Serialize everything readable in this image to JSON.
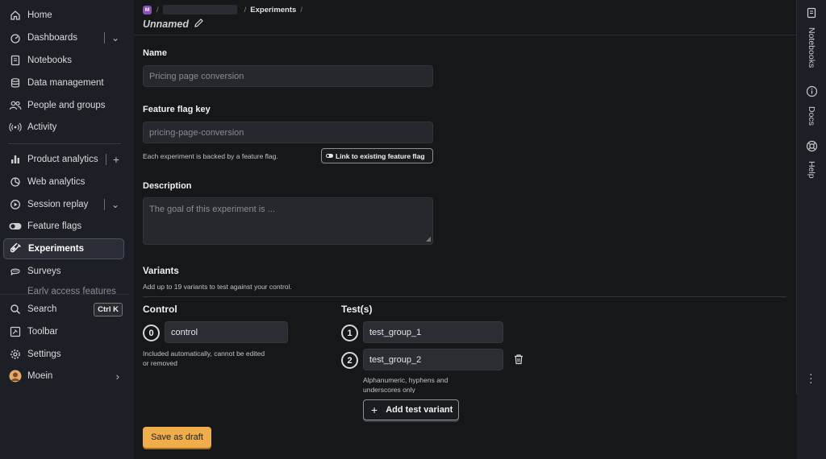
{
  "sidebar": {
    "items": [
      {
        "label": "Home",
        "icon": "home-icon"
      },
      {
        "label": "Dashboards",
        "icon": "dashboards-icon"
      },
      {
        "label": "Notebooks",
        "icon": "notebook-icon"
      },
      {
        "label": "Data management",
        "icon": "database-icon"
      },
      {
        "label": "People and groups",
        "icon": "people-icon"
      },
      {
        "label": "Activity",
        "icon": "activity-icon"
      },
      {
        "label": "Product analytics",
        "icon": "bar-chart-icon"
      },
      {
        "label": "Web analytics",
        "icon": "pie-chart-icon"
      },
      {
        "label": "Session replay",
        "icon": "play-icon"
      },
      {
        "label": "Feature flags",
        "icon": "toggle-icon"
      },
      {
        "label": "Experiments",
        "icon": "flask-icon",
        "active": true
      },
      {
        "label": "Surveys",
        "icon": "chat-icon"
      },
      {
        "label": "Early access features",
        "icon": "rocket-icon"
      }
    ],
    "bottom": [
      {
        "label": "Search",
        "shortcut": "Ctrl K",
        "icon": "search-icon"
      },
      {
        "label": "Toolbar",
        "icon": "toolbar-icon"
      },
      {
        "label": "Settings",
        "icon": "gear-icon"
      },
      {
        "label": "Moein",
        "icon": "avatar"
      }
    ]
  },
  "breadcrumb": {
    "badge": "M",
    "current": "Experiments"
  },
  "page": {
    "title": "Unnamed"
  },
  "form": {
    "name_label": "Name",
    "name_placeholder": "Pricing page conversion",
    "flag_label": "Feature flag key",
    "flag_placeholder": "pricing-page-conversion",
    "flag_helper": "Each experiment is backed by a feature flag.",
    "link_flag_button": "Link to existing feature flag",
    "description_label": "Description",
    "description_placeholder": "The goal of this experiment is ...",
    "variants_label": "Variants",
    "variants_helper": "Add up to 19 variants to test against your control.",
    "control_label": "Control",
    "tests_label": "Test(s)",
    "control": {
      "number": "0",
      "value": "control",
      "note_line1": "Included automatically, cannot be edited",
      "note_line2": "or removed"
    },
    "tests": [
      {
        "number": "1",
        "value": "test_group_1"
      },
      {
        "number": "2",
        "value": "test_group_2"
      }
    ],
    "tests_note_line1": "Alphanumeric, hyphens and",
    "tests_note_line2": "underscores only",
    "add_variant_button": "Add test variant",
    "save_button": "Save as draft"
  },
  "right_rail": {
    "items": [
      {
        "label": "Notebooks",
        "icon": "notebook-icon"
      },
      {
        "label": "Docs",
        "icon": "info-icon"
      },
      {
        "label": "Help",
        "icon": "lifebuoy-icon"
      }
    ]
  },
  "colors": {
    "accent": "#f0ad4c",
    "badge": "#8a52b8",
    "background": "#161719",
    "sidebar": "#1d1f27"
  }
}
